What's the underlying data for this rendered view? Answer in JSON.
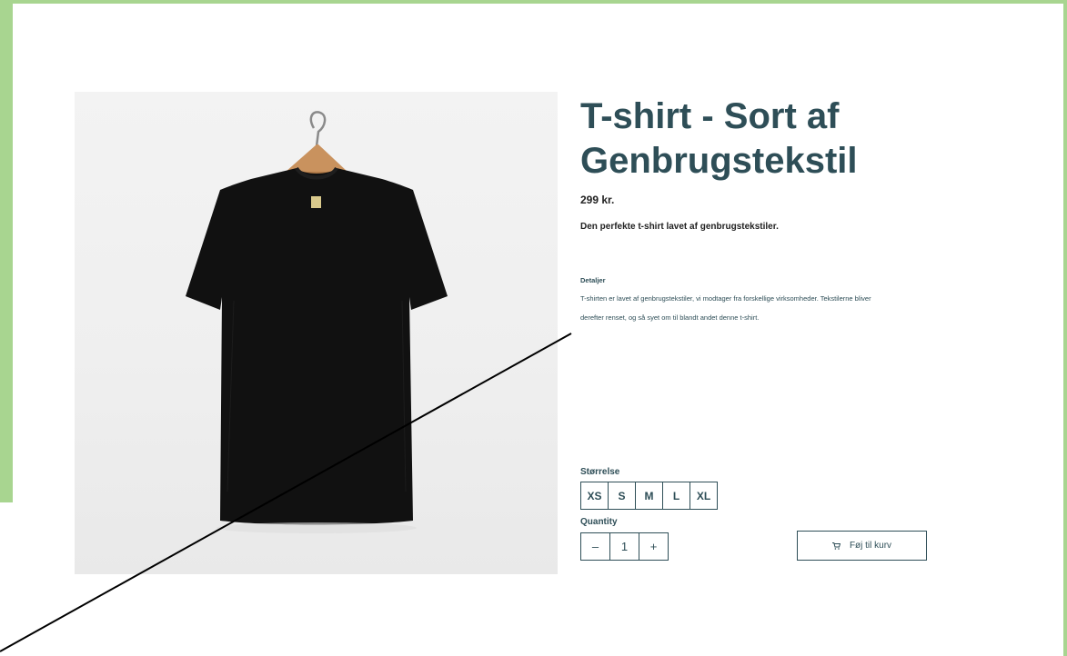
{
  "product": {
    "title": "T-shirt - Sort af Genbrugstekstil",
    "price": "299 kr.",
    "tagline": "Den perfekte t-shirt lavet af genbrugstekstiler.",
    "details_heading": "Detaljer",
    "details_text": "T-shirten er lavet af genbrugstekstiler, vi modtager fra forskellige virksomheder. Tekstilerne bliver derefter renset, og så syet om til blandt andet denne t-shirt."
  },
  "size": {
    "label": "Størrelse",
    "options": [
      "XS",
      "S",
      "M",
      "L",
      "XL"
    ]
  },
  "quantity": {
    "label": "Quantity",
    "decrement": "–",
    "value": "1",
    "increment": "+"
  },
  "cart": {
    "button_label": "Føj til kurv",
    "icon": "cart-icon"
  },
  "colors": {
    "accent": "#2e4e57",
    "frame_green": "#a8d590"
  }
}
